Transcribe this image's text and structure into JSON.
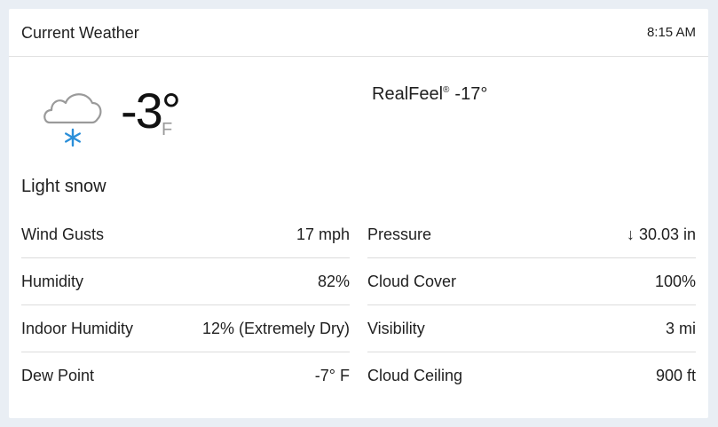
{
  "header": {
    "title": "Current Weather",
    "time": "8:15 AM"
  },
  "current": {
    "icon": "cloud-snow-icon",
    "temperature": "-3°",
    "unit": "F",
    "realfeel_label": "RealFeel",
    "realfeel_mark": "®",
    "realfeel_value": "-17°",
    "condition": "Light snow"
  },
  "details": {
    "left": [
      {
        "label": "Wind Gusts",
        "value": "17 mph"
      },
      {
        "label": "Humidity",
        "value": "82%"
      },
      {
        "label": "Indoor Humidity",
        "value": "12% (Extremely Dry)"
      },
      {
        "label": "Dew Point",
        "value": "-7° F"
      }
    ],
    "right": [
      {
        "label": "Pressure",
        "value": "↓ 30.03 in"
      },
      {
        "label": "Cloud Cover",
        "value": "100%"
      },
      {
        "label": "Visibility",
        "value": "3 mi"
      },
      {
        "label": "Cloud Ceiling",
        "value": "900 ft"
      }
    ]
  },
  "colors": {
    "background": "#e9eef4",
    "card": "#ffffff",
    "snowflake": "#2b8fd9",
    "cloud_outline": "#9a9a9a"
  }
}
